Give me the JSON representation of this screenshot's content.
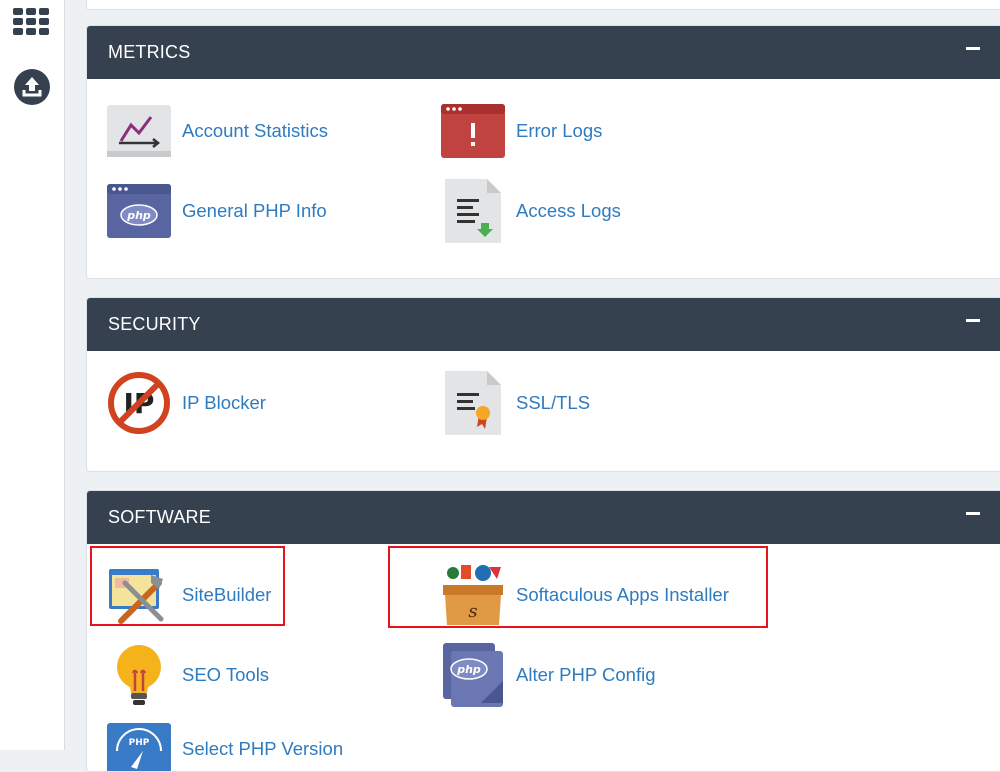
{
  "sidebar": {
    "icons": [
      "apps-grid-icon",
      "upload-icon"
    ]
  },
  "metrics": {
    "title": "METRICS",
    "items": [
      {
        "label": "Account Statistics",
        "icon": "statistics-chart-icon"
      },
      {
        "label": "Error Logs",
        "icon": "error-log-window-icon"
      },
      {
        "label": "General PHP Info",
        "icon": "php-window-icon"
      },
      {
        "label": "Access Logs",
        "icon": "access-log-document-icon"
      }
    ]
  },
  "security": {
    "title": "SECURITY",
    "items": [
      {
        "label": "IP Blocker",
        "icon": "ip-blocker-icon"
      },
      {
        "label": "SSL/TLS",
        "icon": "ssl-certificate-icon"
      }
    ]
  },
  "software": {
    "title": "SOFTWARE",
    "items": [
      {
        "label": "SiteBuilder",
        "icon": "sitebuilder-tools-icon"
      },
      {
        "label": "Softaculous Apps Installer",
        "icon": "softaculous-box-icon"
      },
      {
        "label": "SEO Tools",
        "icon": "lightbulb-icon"
      },
      {
        "label": "Alter PHP Config",
        "icon": "php-config-icon"
      },
      {
        "label": "Select PHP Version",
        "icon": "php-version-gauge-icon"
      }
    ]
  },
  "colors": {
    "panel_header": "#35414f",
    "link": "#2f7bbf",
    "highlight": "#e8141c"
  }
}
